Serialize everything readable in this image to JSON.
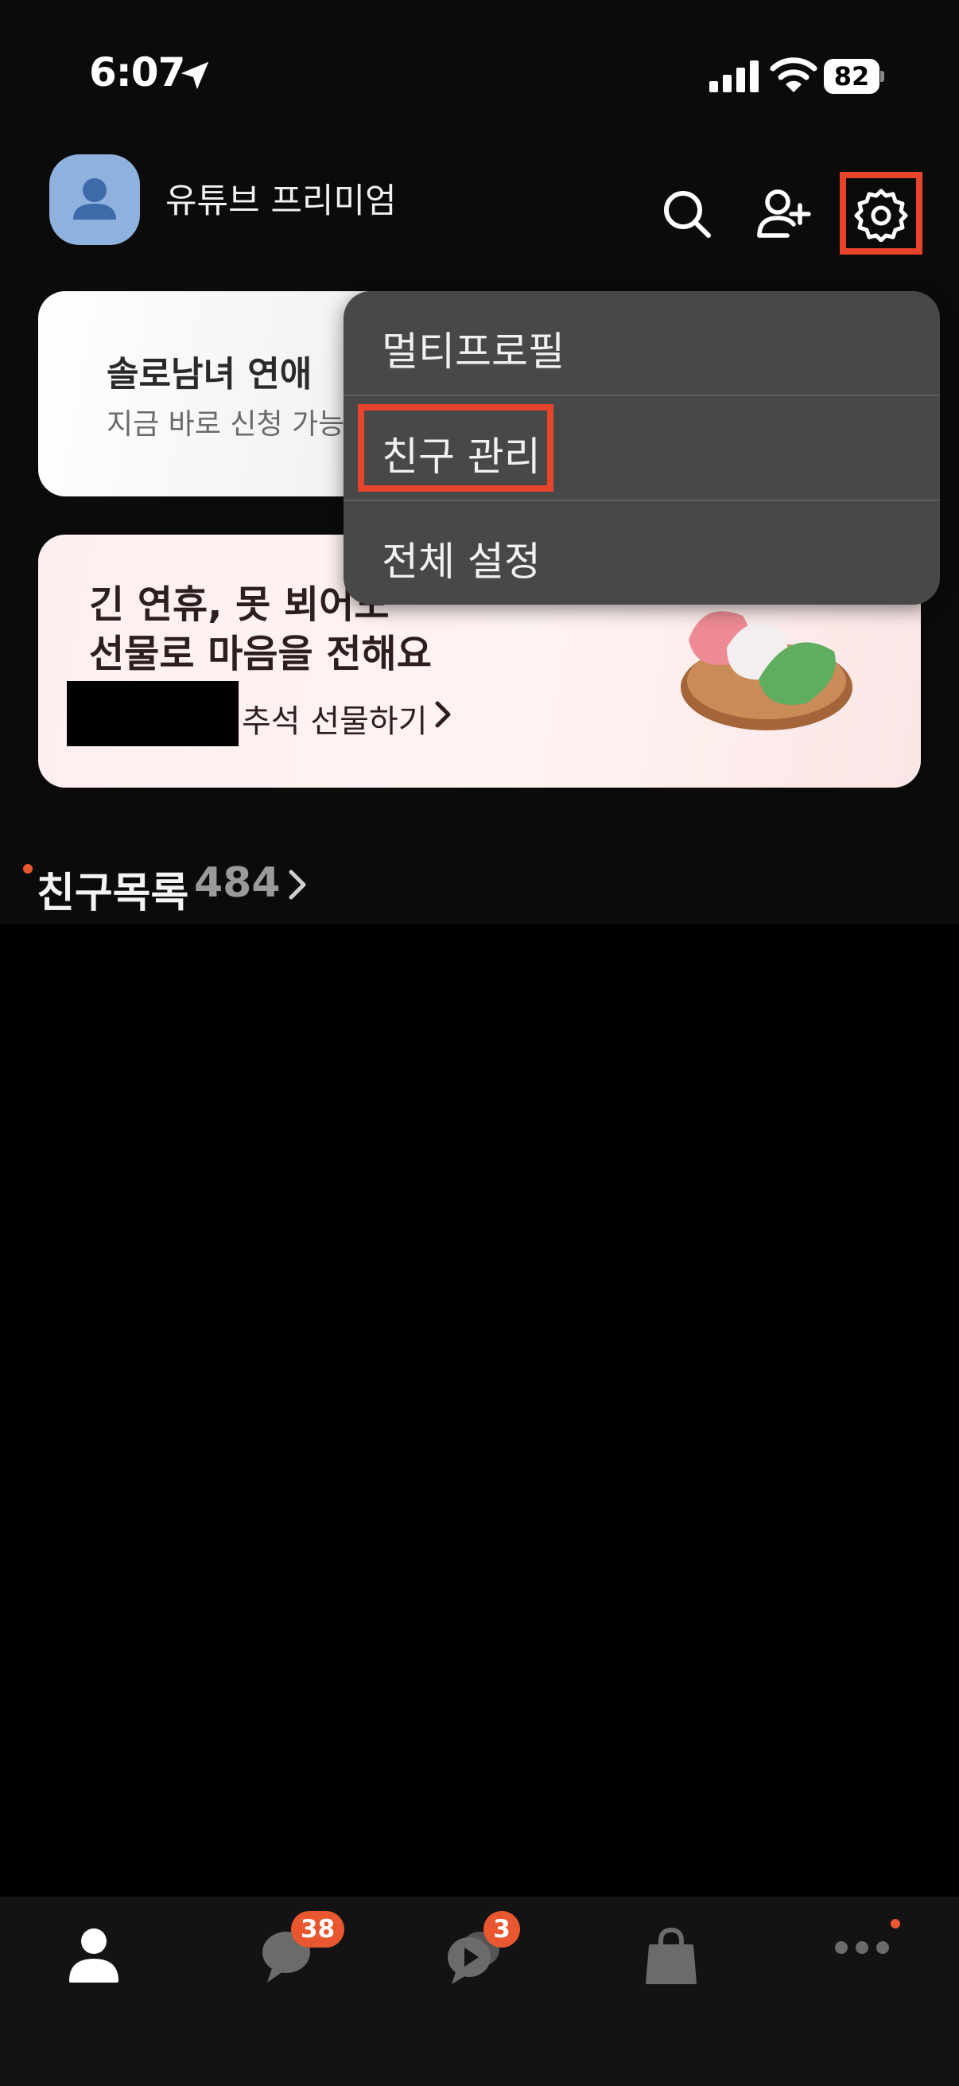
{
  "status_bar": {
    "time": "6:07",
    "battery": "82"
  },
  "header": {
    "profile_name": "유튜브 프리미엄"
  },
  "banner_ad": {
    "title": "솔로남녀 연애 ",
    "subtitle": "지금 바로 신청 가능"
  },
  "banner_gift": {
    "line1": "긴 연휴, 못 뵈어도",
    "line2": "선물로 마음을 전해요",
    "link": "추석 선물하기"
  },
  "menu": {
    "items": [
      "멀티프로필",
      "친구 관리",
      "전체 설정"
    ]
  },
  "friends": {
    "title": "친구목록",
    "count": "484"
  },
  "tabbar": {
    "tabs": [
      {
        "icon": "person-icon",
        "badge": ""
      },
      {
        "icon": "chat-icon",
        "badge": "38"
      },
      {
        "icon": "openchat-icon",
        "badge": "3"
      },
      {
        "icon": "shopping-icon",
        "badge": ""
      },
      {
        "icon": "more-icon",
        "badge": ""
      }
    ]
  },
  "colors": {
    "accent": "#e8572f",
    "highlight": "#e8432b",
    "menu_bg": "#484848",
    "avatar": "#8fb1de"
  }
}
